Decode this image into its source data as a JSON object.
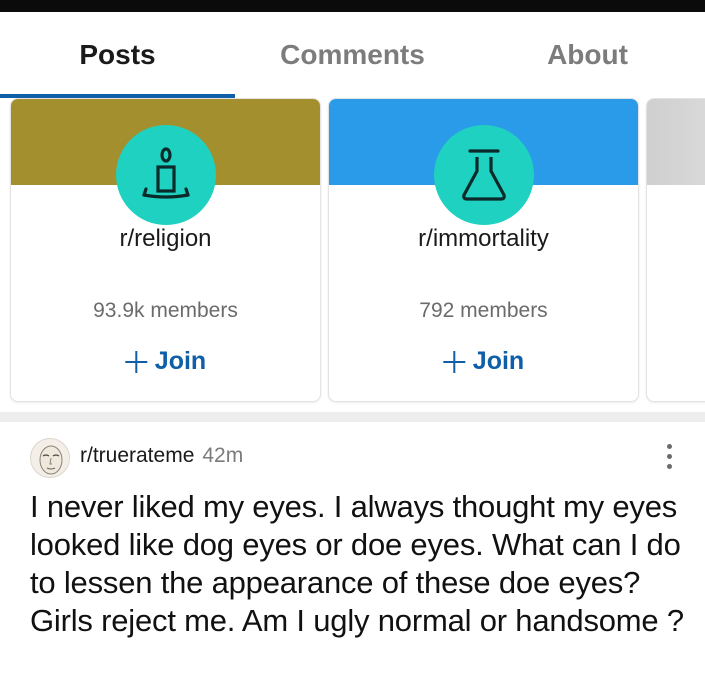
{
  "tabs": [
    {
      "label": "Posts",
      "active": true
    },
    {
      "label": "Comments",
      "active": false
    },
    {
      "label": "About",
      "active": false
    }
  ],
  "communities": [
    {
      "name": "r/religion",
      "members": "93.9k members",
      "join_label": "Join",
      "banner_color": "#a48f2e",
      "icon": "meditation-candle-icon",
      "icon_bg": "#1fd1c0"
    },
    {
      "name": "r/immortality",
      "members": "792 members",
      "join_label": "Join",
      "banner_color": "#2a9be8",
      "icon": "flask-icon",
      "icon_bg": "#1fd1c0"
    },
    {
      "name": "",
      "members": "",
      "join_label": "",
      "banner_color": "#d0d0d0",
      "icon": "",
      "icon_bg": ""
    }
  ],
  "post": {
    "subreddit": "r/truerateme",
    "time": "42m",
    "title": "I never liked my eyes. I always thought my eyes looked like dog eyes or doe eyes. What can I do to lessen the appearance of these doe eyes? Girls reject me. Am I ugly normal or handsome ?"
  },
  "colors": {
    "accent": "#0f5fa8",
    "tab_inactive": "#7c7c7c"
  }
}
